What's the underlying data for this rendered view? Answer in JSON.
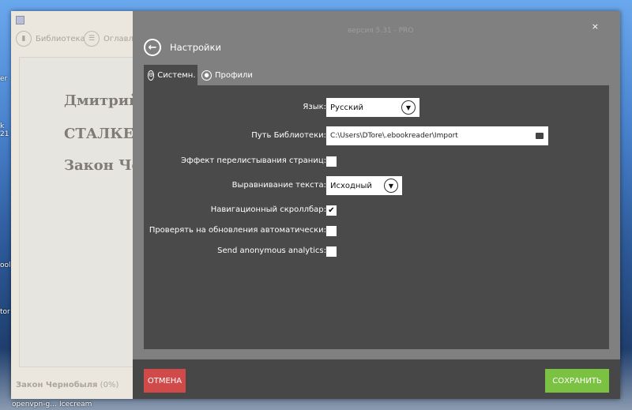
{
  "desktop": {
    "labels": [
      "er",
      "k",
      "21",
      "ool",
      "tor"
    ],
    "taskbar": [
      "openvpn-g...",
      "Icecream"
    ]
  },
  "reader": {
    "toolbar": {
      "library": "Библиотека",
      "contents": "Оглавлен"
    },
    "page_lines": [
      "Дмитрий",
      "СТАЛКЕ",
      "Закон Чер"
    ],
    "status_title": "Закон Чернобыля",
    "status_progress": "(0%)"
  },
  "settings": {
    "version": "версия 5.31 - PRO",
    "close": "×",
    "title": "Настройки",
    "tabs": [
      {
        "label": "Системн.",
        "active": true
      },
      {
        "label": "Профили",
        "active": false
      }
    ],
    "fields": {
      "language": {
        "label": "Язык:",
        "value": "Русский"
      },
      "library_path": {
        "label": "Путь Библиотеки:",
        "value": "C:\\Users\\DTore\\.ebookreader\\Import"
      },
      "page_flip": {
        "label": "Эффект перелистывания страниц:",
        "checked": false
      },
      "text_align": {
        "label": "Выравнивание текста:",
        "value": "Исходный"
      },
      "nav_scrollbar": {
        "label": "Навигационный скроллбар:",
        "checked": true,
        "mark": "✔"
      },
      "auto_update": {
        "label": "Проверять на обновления автоматически:",
        "checked": false
      },
      "analytics": {
        "label": "Send anonymous analytics:",
        "checked": false
      }
    },
    "cancel": "ОТМЕНА",
    "save": "СОХРАНИТЬ"
  }
}
